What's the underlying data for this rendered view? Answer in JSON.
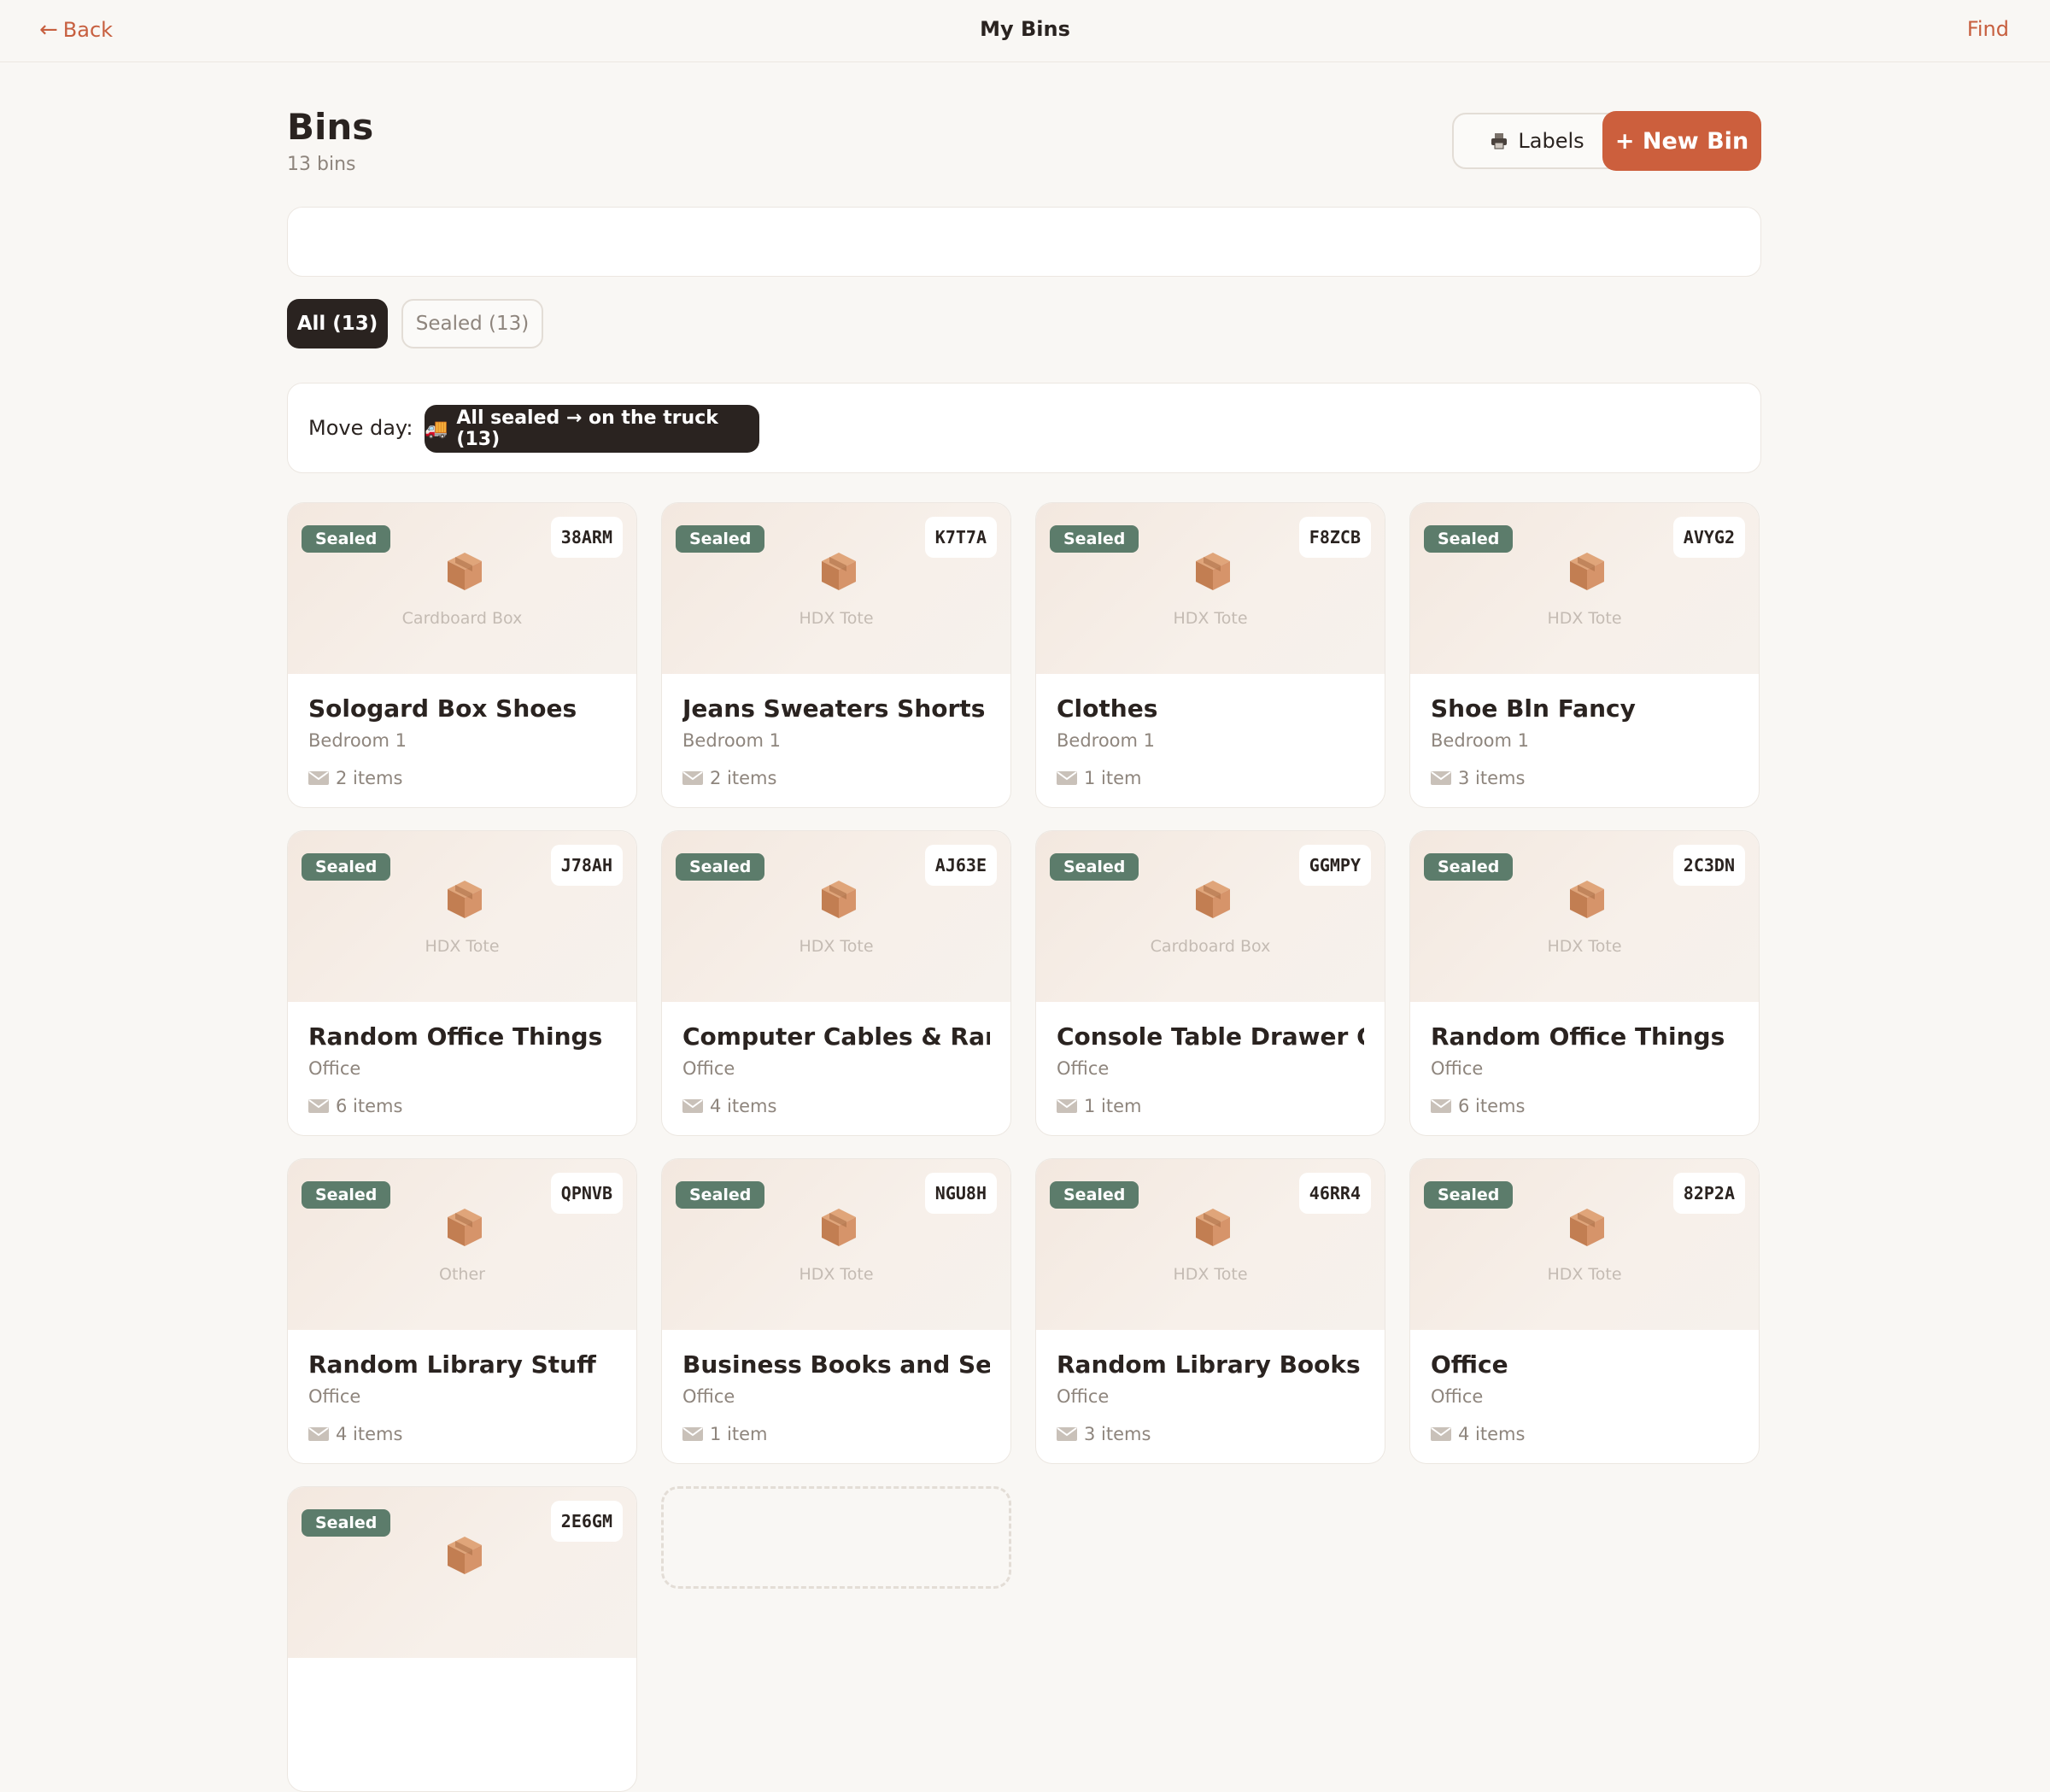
{
  "topbar": {
    "back_label": "Back",
    "title": "My Bins",
    "find_label": "Find"
  },
  "header": {
    "title": "Bins",
    "count_label": "13 bins"
  },
  "actions": {
    "labels_button": "Labels",
    "new_bin_button": "+ New Bin"
  },
  "search": {
    "value": "",
    "placeholder": ""
  },
  "filters": [
    {
      "label": "All (13)",
      "selected": true
    },
    {
      "label": "Sealed (13)",
      "selected": false
    }
  ],
  "move_day": {
    "label": "Move day:",
    "button_label": "All sealed → on the truck (13)"
  },
  "icons": {
    "back": "arrow-left-icon",
    "printer": "printer-icon",
    "truck": "truck-icon",
    "box": "box-icon",
    "items": "envelope-icon"
  },
  "colors": {
    "accent": "#cc5f3d",
    "dark": "#2a2320",
    "sealed_badge": "#5c7c6b",
    "background": "#f9f7f4"
  },
  "bins": [
    {
      "status": "Sealed",
      "code": "38ARM",
      "type": "Cardboard Box",
      "name": "Sologard Box Shoes",
      "room": "Bedroom 1",
      "items": "2 items"
    },
    {
      "status": "Sealed",
      "code": "K7T7A",
      "type": "HDX Tote",
      "name": "Jeans Sweaters Shorts",
      "room": "Bedroom 1",
      "items": "2 items"
    },
    {
      "status": "Sealed",
      "code": "F8ZCB",
      "type": "HDX Tote",
      "name": "Clothes",
      "room": "Bedroom 1",
      "items": "1 item"
    },
    {
      "status": "Sealed",
      "code": "AVYG2",
      "type": "HDX Tote",
      "name": "Shoe Bln Fancy",
      "room": "Bedroom 1",
      "items": "3 items"
    },
    {
      "status": "Sealed",
      "code": "J78AH",
      "type": "HDX Tote",
      "name": "Random Office Things",
      "room": "Office",
      "items": "6 items"
    },
    {
      "status": "Sealed",
      "code": "AJ63E",
      "type": "HDX Tote",
      "name": "Computer Cables & Random Items",
      "room": "Office",
      "items": "4 items"
    },
    {
      "status": "Sealed",
      "code": "GGMPY",
      "type": "Cardboard Box",
      "name": "Console Table Drawer Contents",
      "room": "Office",
      "items": "1 item"
    },
    {
      "status": "Sealed",
      "code": "2C3DN",
      "type": "HDX Tote",
      "name": "Random Office Things",
      "room": "Office",
      "items": "6 items"
    },
    {
      "status": "Sealed",
      "code": "QPNVB",
      "type": "Other",
      "name": "Random Library Stuff",
      "room": "Office",
      "items": "4 items"
    },
    {
      "status": "Sealed",
      "code": "NGU8H",
      "type": "HDX Tote",
      "name": "Business Books and Self Help",
      "room": "Office",
      "items": "1 item"
    },
    {
      "status": "Sealed",
      "code": "46RR4",
      "type": "HDX Tote",
      "name": "Random Library Books",
      "room": "Office",
      "items": "3 items"
    },
    {
      "status": "Sealed",
      "code": "82P2A",
      "type": "HDX Tote",
      "name": "Office",
      "room": "Office",
      "items": "4 items"
    },
    {
      "status": "Sealed",
      "code": "2E6GM",
      "type": "",
      "name": "",
      "room": "",
      "items": ""
    }
  ]
}
